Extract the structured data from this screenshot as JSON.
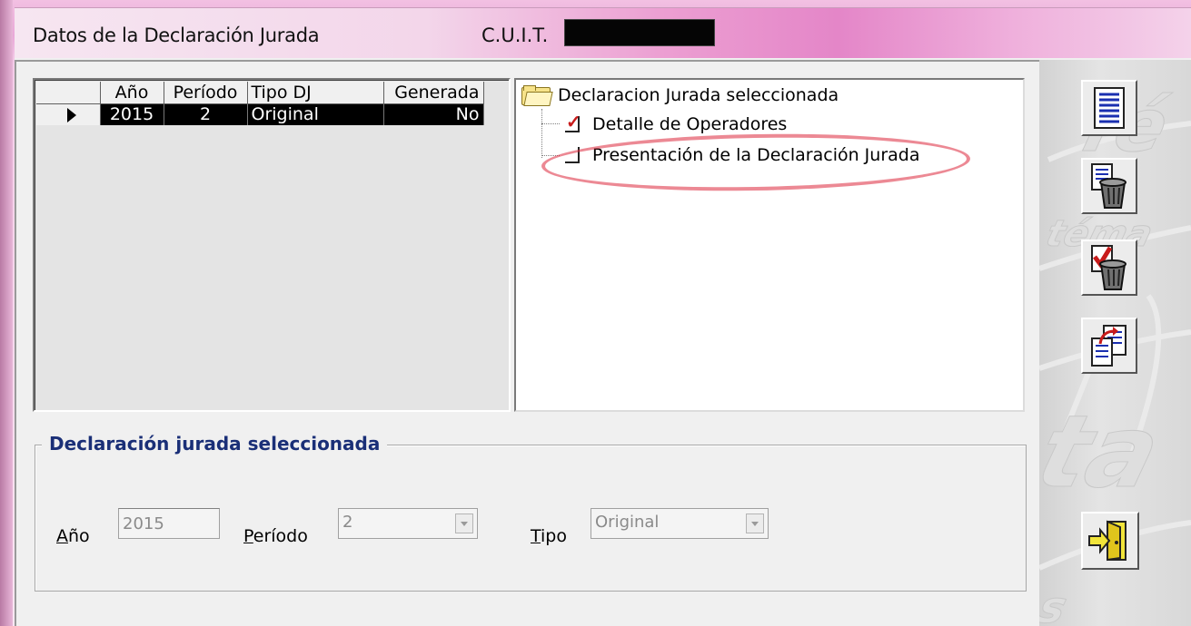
{
  "window": {
    "title": "Datos de la Declaración Jurada",
    "cuit_label": "C.U.I.T."
  },
  "grid": {
    "columns": [
      "",
      "Año",
      "Período",
      "Tipo DJ",
      "Generada"
    ],
    "rows": [
      {
        "indicator": "current-row",
        "anio": "2015",
        "periodo": "2",
        "tipo": "Original",
        "generada": "No"
      }
    ]
  },
  "tree": {
    "root_label": "Declaracion Jurada seleccionada",
    "items": [
      {
        "label": "Detalle de Operadores",
        "checked": true
      },
      {
        "label": "Presentación de la Declaración Jurada",
        "checked": false
      }
    ]
  },
  "groupbox": {
    "title": "Declaración jurada seleccionada",
    "anio_label_ul": "A",
    "anio_label_rest": "ño",
    "anio_value": "2015",
    "periodo_label_ul": "P",
    "periodo_label_rest": "eríodo",
    "periodo_value": "2",
    "tipo_label_ul": "T",
    "tipo_label_rest": "ipo",
    "tipo_value": "Original"
  },
  "toolbar": {
    "icons": [
      "document-list-icon",
      "trash-document-icon",
      "trash-check-icon",
      "copy-document-icon",
      "exit-door-icon"
    ]
  },
  "colors": {
    "title_gradient_accent": "#e486c8",
    "legend_text": "#1a2f77",
    "selected_row_bg": "#000000",
    "highlight_circle": "#dc283c"
  }
}
